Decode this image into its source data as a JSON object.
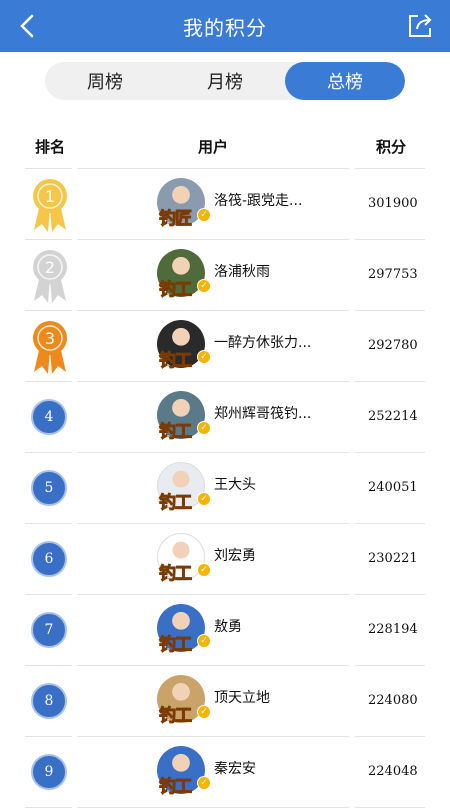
{
  "header": {
    "title": "我的积分",
    "back_icon": "chevron-left-icon",
    "share_icon": "share-icon"
  },
  "tabs": [
    {
      "label": "周榜"
    },
    {
      "label": "月榜"
    },
    {
      "label": "总榜",
      "active": true
    }
  ],
  "table": {
    "columns": {
      "rank": "排名",
      "user": "用户",
      "score": "积分"
    },
    "rows": [
      {
        "rank": "1",
        "name": "洛筏-跟党走...",
        "score": "301900",
        "badge": "钓匠",
        "medal": "gold"
      },
      {
        "rank": "2",
        "name": "洛浦秋雨",
        "score": "297753",
        "badge": "钓工",
        "medal": "silver"
      },
      {
        "rank": "3",
        "name": "一醉方休张力...",
        "score": "292780",
        "badge": "钓工",
        "medal": "bronze"
      },
      {
        "rank": "4",
        "name": "郑州辉哥筏钓...",
        "score": "252214",
        "badge": "钓工"
      },
      {
        "rank": "5",
        "name": "王大头",
        "score": "240051",
        "badge": "钓工"
      },
      {
        "rank": "6",
        "name": "刘宏勇",
        "score": "230221",
        "badge": "钓工"
      },
      {
        "rank": "7",
        "name": "敖勇",
        "score": "228194",
        "badge": "钓工"
      },
      {
        "rank": "8",
        "name": "顶天立地",
        "score": "224080",
        "badge": "钓工"
      },
      {
        "rank": "9",
        "name": "秦宏安",
        "score": "224048",
        "badge": "钓工"
      }
    ]
  },
  "colors": {
    "primary": "#3a7bd5",
    "gold": "#f6c648",
    "silver": "#d3d3d3",
    "bronze": "#ee8a1c",
    "badge": "#ff8a1a"
  }
}
